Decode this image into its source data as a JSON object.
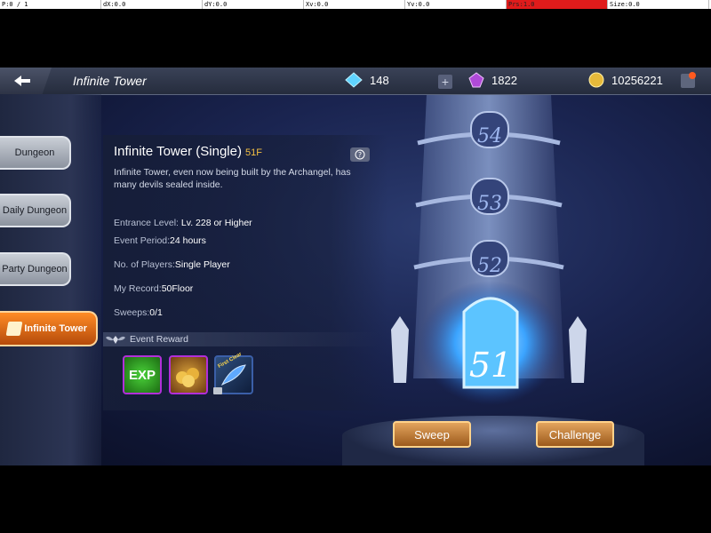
{
  "debug": {
    "p": "P:0 / 1",
    "dx": "dX:0.0",
    "dy": "dY:0.0",
    "xv": "Xv:0.0",
    "yv": "Yv:0.0",
    "prs": "Prs:1.0",
    "size": "Size:0.0"
  },
  "header": {
    "title": "Infinite Tower"
  },
  "currency": {
    "diamonds": "148",
    "crystals": "1822",
    "gold": "10256221"
  },
  "tabs": [
    "Dungeon",
    "Daily Dungeon",
    "Party Dungeon",
    "Infinite Tower"
  ],
  "active_tab": "Infinite Tower",
  "panel": {
    "title": "Infinite Tower (Single)",
    "floor": "51F",
    "description": "Infinite Tower, even now being built by the Archangel, has many devils sealed inside.",
    "entrance_label": "Entrance Level:",
    "entrance_value": "Lv. 228  or Higher",
    "period_label": "Event Period:",
    "period_value": "24 hours",
    "players_label": "No. of Players:",
    "players_value": "Single Player",
    "record_label": "My Record:",
    "record_value": "50Floor",
    "sweeps_label": "Sweeps:",
    "sweeps_value": "0/1",
    "event_reward_label": "Event Reward",
    "reward_exp": "EXP",
    "reward_feather_tag": "First Clear"
  },
  "tower": {
    "floors": [
      "54",
      "53",
      "52"
    ],
    "current_floor": "51"
  },
  "buttons": {
    "sweep": "Sweep",
    "challenge": "Challenge"
  },
  "colors": {
    "accent_orange": "#ff8c26",
    "gold_text": "#f5c043",
    "button_gold": "#e3a45d",
    "record_red": "#e01b1b"
  }
}
